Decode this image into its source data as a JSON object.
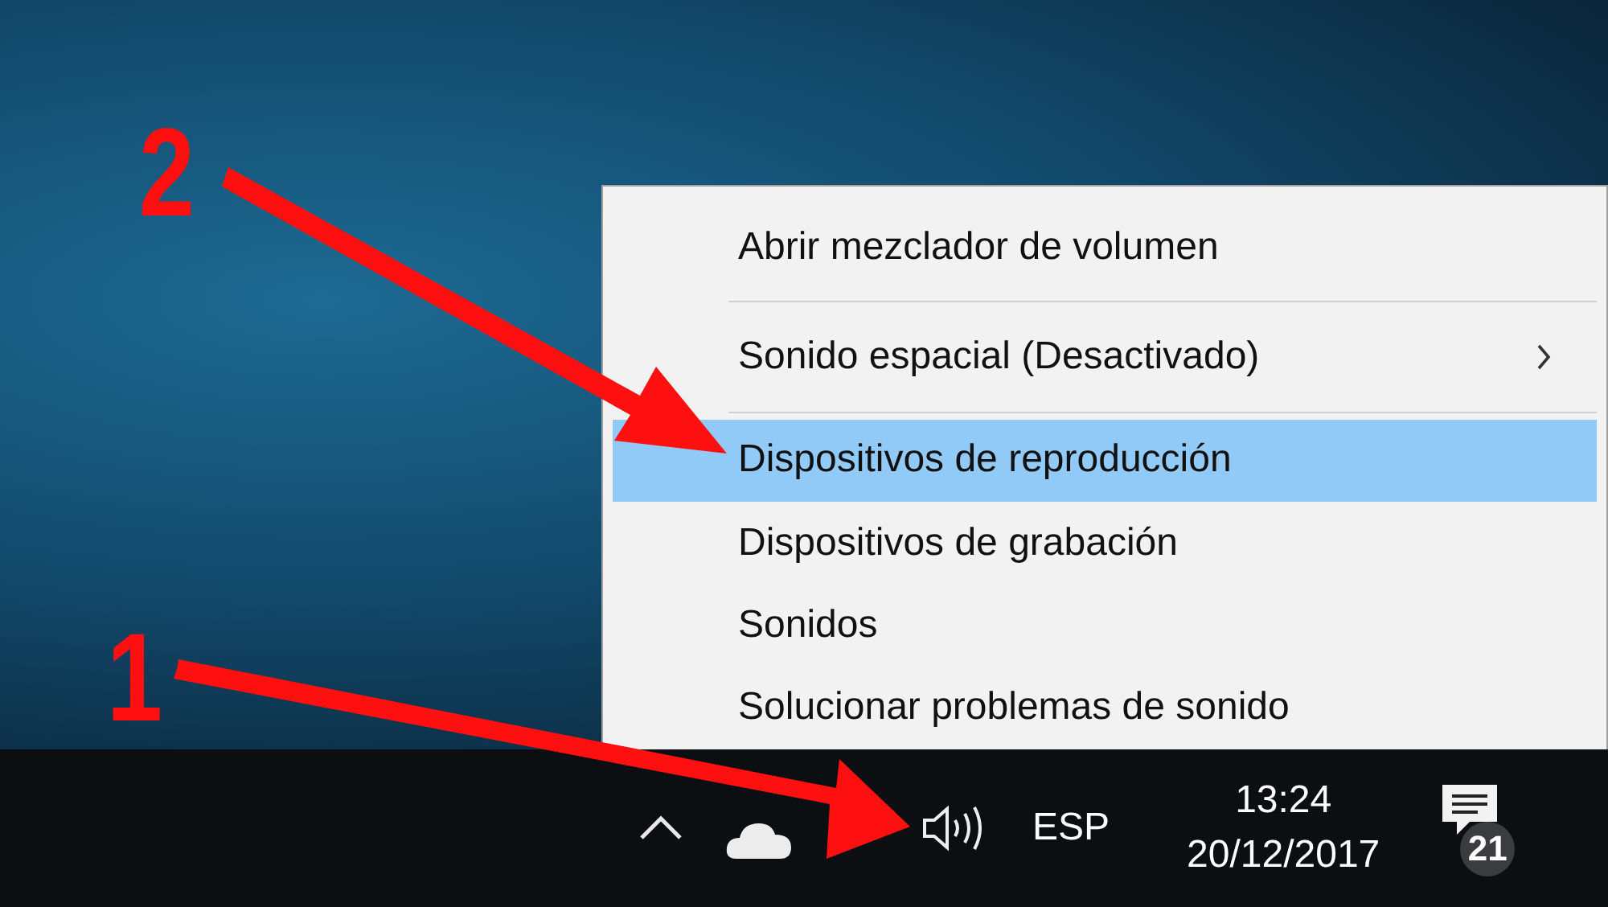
{
  "annotations": [
    {
      "label": "2"
    },
    {
      "label": "1"
    }
  ],
  "context_menu": {
    "items": [
      {
        "label": "Abrir mezclador de volumen",
        "selected": false,
        "submenu": false,
        "separator_after": true
      },
      {
        "label": "Sonido espacial (Desactivado)",
        "selected": false,
        "submenu": true,
        "separator_after": true
      },
      {
        "label": "Dispositivos de reproducción",
        "selected": true,
        "submenu": false,
        "separator_after": false
      },
      {
        "label": "Dispositivos de grabación",
        "selected": false,
        "submenu": false,
        "separator_after": false
      },
      {
        "label": "Sonidos",
        "selected": false,
        "submenu": false,
        "separator_after": false
      },
      {
        "label": "Solucionar problemas de sonido",
        "selected": false,
        "submenu": false,
        "separator_after": false
      }
    ]
  },
  "taskbar": {
    "language": "ESP",
    "clock": {
      "time": "13:24",
      "date": "20/12/2017"
    },
    "notifications": {
      "count": "21"
    }
  }
}
